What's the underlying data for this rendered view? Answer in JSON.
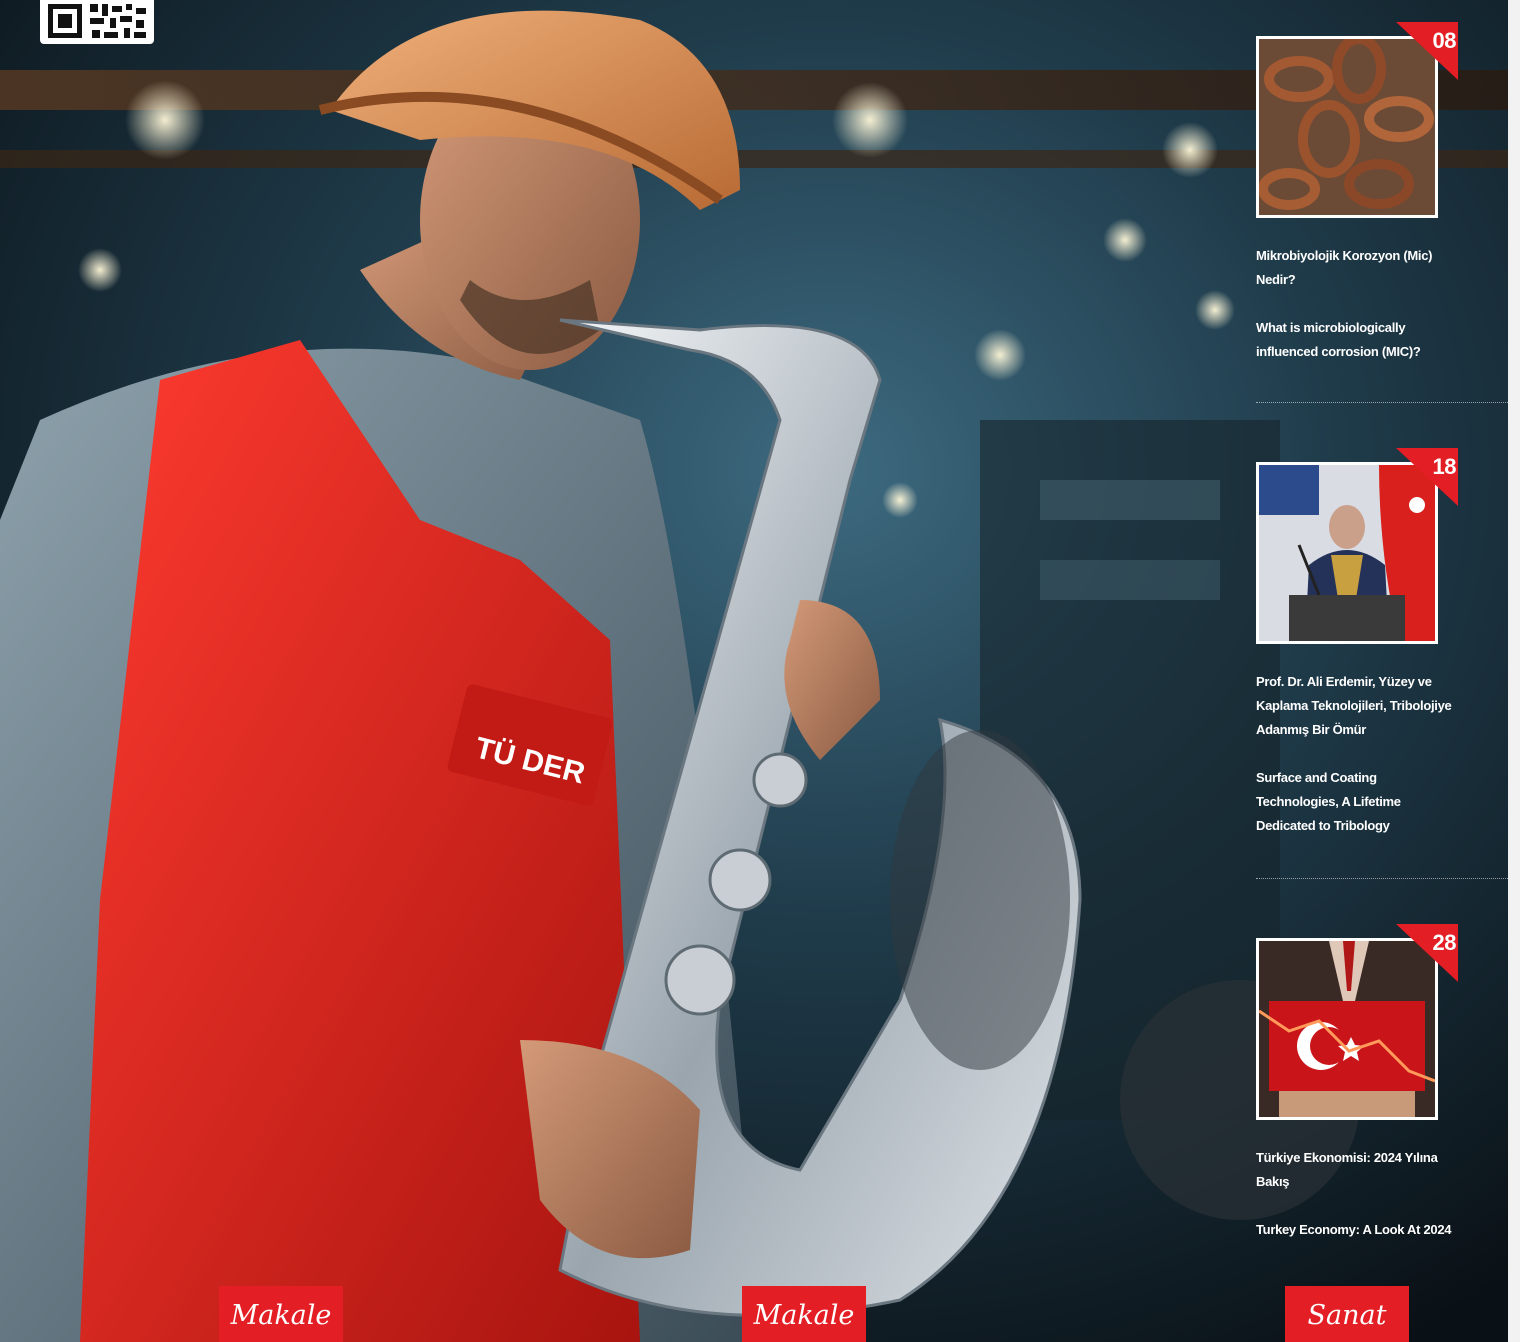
{
  "cover": {
    "image": "saxophone-worker-illustration",
    "apron_brand": "TÜ   DER",
    "qr": "qr-code"
  },
  "articles": [
    {
      "page": "08",
      "image": "rusty-chain-photo",
      "title_tr": "Mikrobiyolojik Korozyon (Mic) Nedir?",
      "title_en": "What is microbiologically influenced corrosion (MIC)?"
    },
    {
      "page": "18",
      "image": "speaker-at-podium-photo",
      "title_tr": "Prof. Dr. Ali Erdemir, Yüzey ve Kaplama Teknolojileri, Tribolojiye Adanmış Bir Ömür",
      "title_en": "Surface and Coating Technologies, A Lifetime Dedicated to Tribology"
    },
    {
      "page": "28",
      "image": "turkish-flag-chart-photo",
      "title_tr": "Türkiye Ekonomisi:  2024 Yılına Bakış",
      "title_en": "Turkey Economy:  A Look At 2024"
    }
  ],
  "tags": [
    "Makale",
    "Makale",
    "Sanat"
  ],
  "colors": {
    "accent": "#e31e24",
    "text": "#ffffff",
    "background": "#0c1217"
  }
}
